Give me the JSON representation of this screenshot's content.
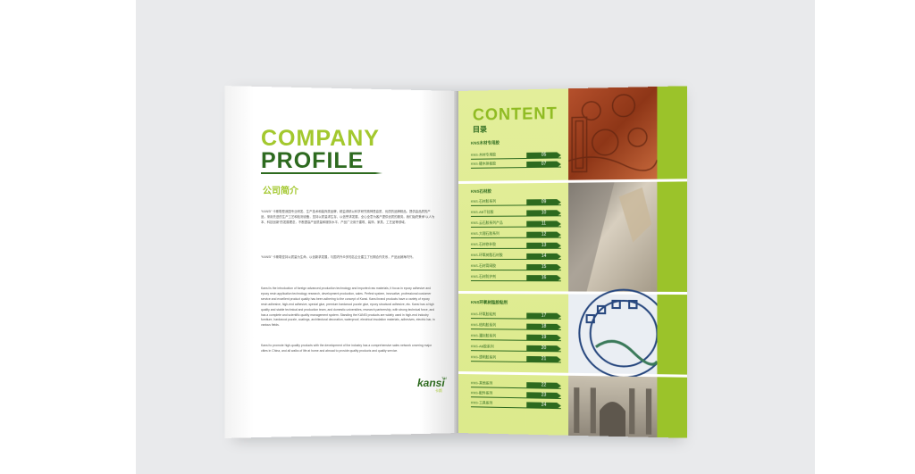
{
  "left_page": {
    "title_line1": "COMPANY",
    "title_line2": "PROFILE",
    "title_cn": "公司简介",
    "paragraphs": [
      "“KANSI” 卡斯勒是我国专业研发、生产技术和装饰类品牌，精益求精以科学研究精神是高质、优质的品牌精品。提供高品质的产品，采用先进的生产工艺和检测设备，坚持以质量求生存、以信誉求发展，全心全意为客户提供优质的服务。我们始终秉承“以人为本、科技创新”的发展理念，不断提高产品质量和服务水平，产品广泛用于建筑、装饰、家具、工艺品等领域。",
      "“KANSI” 卡斯勒坚持以质量为生命，以创新求发展，与国内外众多知名企业建立了长期合作关系，产品远销海内外。",
      "Kansi is the introduction of foreign advanced production technology and imported raw materials, it focus in epoxy adhesive and epoxy resin application technology research, development production, sales. Perfect system, innovative, professional customer service and excellent product quality has been adhering to the concept of Kansi. Kansi brand products have a variety of epoxy resin adhesive, high-end adhesive, special glue, premium hardwood puzzle glue, epoxy structural adhesive, etc. Kansi has a high quality and stable technical and production team, and domestic universities, research partnership, with strong technical force, and has a complete and scientific quality management system. Standing the KANSI products are widely used in high-end industry furniture, hardwood puzzle, coatings, architectural decoration, waterproof, electrical insulation materials, adhesives, electric bar, in various fields.",
      "Kansi to promote high-quality products with the development of the industry has a comprehensive sales network covering major cities in China, and all walks of life at home and abroad to provide quality products and quality service."
    ],
    "logo_text": "kansi",
    "logo_tm": "TM",
    "logo_sub": "卡斯"
  },
  "right_page": {
    "title": "CONTENT",
    "title_cn": "目录",
    "sections": [
      {
        "title": "KNS木材专用胶",
        "entries": [
          {
            "label": "KNS-木材专用胶",
            "num": "05"
          },
          {
            "label": "KNS-硬木拼板胶",
            "num": "07"
          }
        ]
      },
      {
        "title": "KNS石材胶",
        "entries": [
          {
            "label": "KNS-石材胶系列",
            "num": "09"
          },
          {
            "label": "KNS-AB干挂胶",
            "num": "10"
          },
          {
            "label": "KNS-云石胶系列产品",
            "num": "11"
          },
          {
            "label": "KNS-大理石胶系列",
            "num": "12"
          },
          {
            "label": "KNS-石材修补胶",
            "num": "13"
          },
          {
            "label": "KNS-环氧树脂石材胶",
            "num": "14"
          },
          {
            "label": "KNS-石材背网胶",
            "num": "15"
          },
          {
            "label": "KNS-石材防护剂",
            "num": "16"
          }
        ]
      },
      {
        "title": "KNS环氧树脂胶粘剂",
        "entries": [
          {
            "label": "KNS-环氧胶粘剂",
            "num": "17"
          },
          {
            "label": "KNS-结构胶系列",
            "num": "18"
          },
          {
            "label": "KNS-灌封胶系列",
            "num": "19"
          },
          {
            "label": "KNS-AB胶系列",
            "num": "20"
          },
          {
            "label": "KNS-透明胶系列",
            "num": "21"
          }
        ]
      },
      {
        "title": "",
        "entries": [
          {
            "label": "KNS-其他系列",
            "num": "22"
          },
          {
            "label": "KNS-配件系列",
            "num": "23"
          },
          {
            "label": "KNS-工具系列",
            "num": "24"
          }
        ]
      }
    ]
  },
  "colors": {
    "accent_light": "#a3c82e",
    "accent_dark": "#2d6a1f",
    "toc_bg": "#e0ec94",
    "strip": "#9bc32a",
    "backdrop": "#e9eaec"
  }
}
